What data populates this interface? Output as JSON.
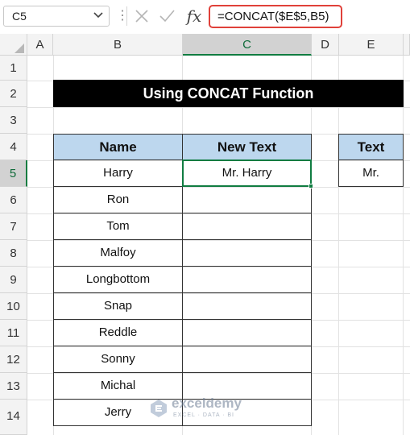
{
  "formula_bar": {
    "name_box": "C5",
    "fx": "fx",
    "formula": "=CONCAT($E$5,B5)"
  },
  "columns": [
    "A",
    "B",
    "C",
    "D",
    "E"
  ],
  "rows": [
    "1",
    "2",
    "3",
    "4",
    "5",
    "6",
    "7",
    "8",
    "9",
    "10",
    "11",
    "12",
    "13",
    "14"
  ],
  "selected": {
    "column": "C",
    "row": "5"
  },
  "sheet": {
    "title": "Using CONCAT Function",
    "main_table": {
      "headers": [
        "Name",
        "New Text"
      ],
      "rows": [
        [
          "Harry",
          "Mr. Harry"
        ],
        [
          "Ron",
          ""
        ],
        [
          "Tom",
          ""
        ],
        [
          "Malfoy",
          ""
        ],
        [
          "Longbottom",
          ""
        ],
        [
          "Snap",
          ""
        ],
        [
          "Reddle",
          ""
        ],
        [
          "Sonny",
          ""
        ],
        [
          "Michal",
          ""
        ],
        [
          "Jerry",
          ""
        ]
      ]
    },
    "side_table": {
      "header": "Text",
      "value": "Mr."
    }
  },
  "watermark": {
    "name": "exceldemy",
    "tagline": "EXCEL · DATA · BI"
  },
  "colors": {
    "header_fill": "#bdd7ee",
    "title_fill": "#000000",
    "selection_green": "#107c41",
    "formula_highlight": "#e0413a"
  }
}
